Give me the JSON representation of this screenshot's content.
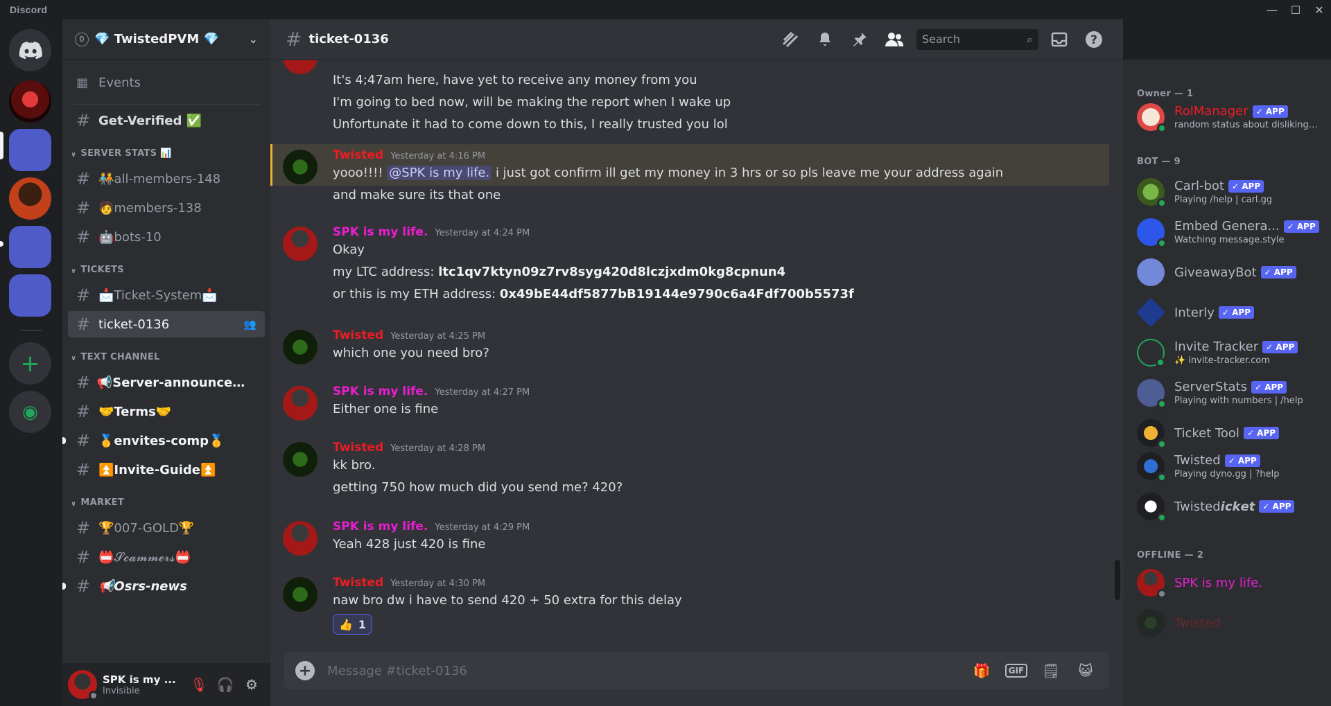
{
  "app": {
    "title": "Discord"
  },
  "window": {
    "minimize": "—",
    "maximize": "☐",
    "close": "✕"
  },
  "server": {
    "name": "💎 TwistedPVM 💎",
    "boost_count": "0"
  },
  "sidebar": {
    "events_label": "Events",
    "top_channels": [
      {
        "name": "Get-Verified ✅"
      }
    ],
    "categories": [
      {
        "name": "SERVER STATS 📊",
        "channels": [
          {
            "name": "🧑‍🤝‍🧑all-members-148"
          },
          {
            "name": "🧑members-138"
          },
          {
            "name": "🤖bots-10"
          }
        ]
      },
      {
        "name": "TICKETS",
        "channels": [
          {
            "name": "📩Ticket-System📩"
          },
          {
            "name": "ticket-0136"
          }
        ]
      },
      {
        "name": "TEXT CHANNEL",
        "channels": [
          {
            "name": "📢Server-announceme..."
          },
          {
            "name": "🤝Terms🤝"
          },
          {
            "name": "🥇envites-comp🥇"
          },
          {
            "name": "⏫Invite-Guide⏫"
          }
        ]
      },
      {
        "name": "MARKET",
        "channels": [
          {
            "name": "🏆007-GOLD🏆"
          },
          {
            "name": "📛𝓢𝓬𝓪𝓶𝓶𝓮𝓻𝓼📛"
          },
          {
            "name": "📢Osrs-news"
          }
        ]
      }
    ]
  },
  "user": {
    "name": "SPK is my ...",
    "status": "Invisible"
  },
  "chat": {
    "channel": "ticket-0136",
    "search_placeholder": "Search",
    "composer_placeholder": "Message #ticket-0136",
    "messages": [
      {
        "lines": [
          "It's 4;47am here, have yet to receive any money from you",
          "I'm going to bed now, will be making the report when I wake up",
          "Unfortunate it had to come down to this, I really trusted you lol"
        ]
      },
      {
        "author": "Twisted",
        "time": "Yesterday at 4:16 PM",
        "line1_pre": "yooo!!!! ",
        "mention": "@SPK is my life.",
        "line1_post": "  i just got confirm ill get  my money in 3 hrs or so pls leave me your address again",
        "line2": "and make sure its that one"
      },
      {
        "author": "SPK is my life.",
        "time": "Yesterday at 4:24 PM",
        "line1": "Okay",
        "ltc_label": "my LTC address: ",
        "ltc": "ltc1qv7ktyn09z7rv8syg420d8lczjxdm0kg8cpnun4",
        "eth_label": "or this is my ETH address: ",
        "eth": "0x49bE44df5877bB19144e9790c6a4Fdf700b5573f"
      },
      {
        "author": "Twisted",
        "time": "Yesterday at 4:25 PM",
        "line1": "which one you need bro?"
      },
      {
        "author": "SPK is my life.",
        "time": "Yesterday at 4:27 PM",
        "line1": "Either one is fine"
      },
      {
        "author": "Twisted",
        "time": "Yesterday at 4:28 PM",
        "line1": "kk bro.",
        "line2": "getting 750 how much did you send me? 420?"
      },
      {
        "author": "SPK is my life.",
        "time": "Yesterday at 4:29 PM",
        "line1": "Yeah 428 just 420 is fine"
      },
      {
        "author": "Twisted",
        "time": "Yesterday at 4:30 PM",
        "line1": "naw bro dw i have to send 420 + 50 extra for this delay",
        "reaction": "👍",
        "reaction_count": "1"
      }
    ]
  },
  "members": {
    "owner_header": "Owner — 1",
    "bot_header": "BOT — 9",
    "offline_header": "OFFLINE — 2",
    "app_tag": "✓ APP",
    "owner": [
      {
        "name": "RolManager",
        "sub": "random status about disliking ..."
      }
    ],
    "bots": [
      {
        "name": "Carl-bot",
        "sub": "Playing /help | carl.gg"
      },
      {
        "name": "Embed Genera...",
        "sub": "Watching message.style"
      },
      {
        "name": "GiveawayBot",
        "sub": ""
      },
      {
        "name": "Interly",
        "sub": ""
      },
      {
        "name": "Invite Tracker",
        "sub": "✨ invite-tracker.com"
      },
      {
        "name": "ServerStats",
        "sub": "Playing with numbers | /help"
      },
      {
        "name": "Ticket Tool",
        "sub": ""
      },
      {
        "name": "Twisted",
        "sub": "Playing dyno.gg | ?help"
      },
      {
        "name": "Twisted𝙞𝙘𝙠𝙚𝙩",
        "sub": ""
      }
    ],
    "offline": [
      {
        "name": "SPK is my life."
      },
      {
        "name": "Twisted"
      }
    ]
  },
  "colors": {
    "twisted": "#ed1c24",
    "spk": "#e91ed1",
    "accent": "#5865f2",
    "online": "#23a55a"
  }
}
